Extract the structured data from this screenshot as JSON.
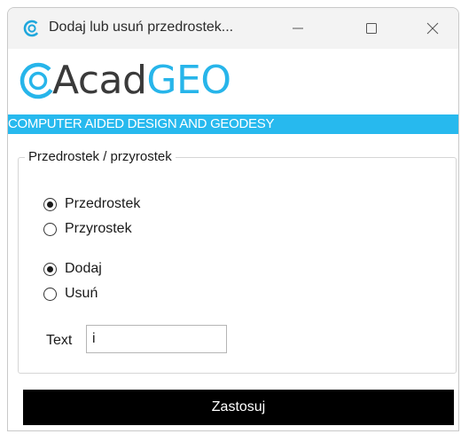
{
  "window": {
    "title": "Dodaj lub usuń przedrostek..."
  },
  "titlebar": {
    "icons": [
      "app-icon",
      "minimize-icon",
      "maximize-icon",
      "close-icon"
    ]
  },
  "logo": {
    "part1": "Acad",
    "part2": "GEO",
    "accent_color": "#27b5ea"
  },
  "banner": {
    "text": "COMPUTER AIDED DESIGN AND GEODESY",
    "color": "#27b9ee"
  },
  "group": {
    "legend": "Przedrostek / przyrostek",
    "position_options": [
      {
        "label": "Przedrostek",
        "checked": true
      },
      {
        "label": "Przyrostek",
        "checked": false
      }
    ],
    "action_options": [
      {
        "label": "Dodaj",
        "checked": true
      },
      {
        "label": "Usuń",
        "checked": false
      }
    ],
    "text_label": "Text",
    "text_value": "i"
  },
  "apply_button": {
    "label": "Zastosuj"
  }
}
